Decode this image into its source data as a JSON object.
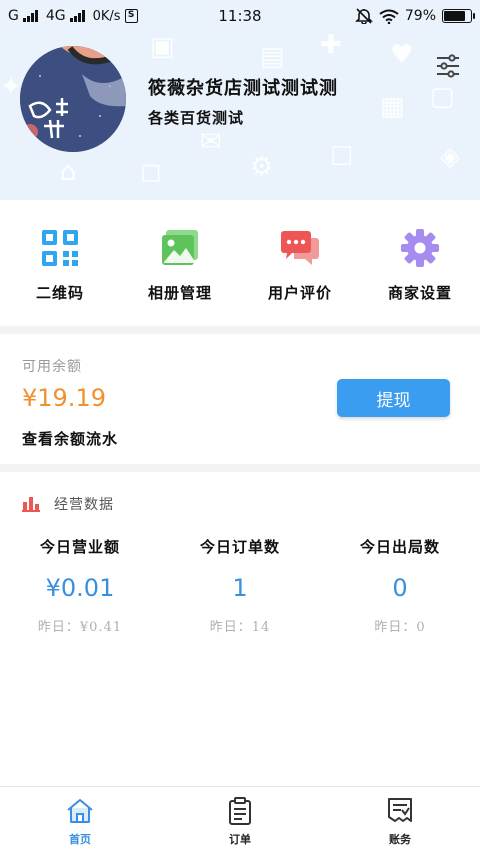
{
  "status_bar": {
    "carrier_a": "G",
    "carrier_b": "4G",
    "speed": "0K/s",
    "s_badge": "S",
    "time": "11:38",
    "battery": "79%",
    "icons": [
      "signal-icon",
      "mute-icon",
      "wifi-icon",
      "battery-icon"
    ]
  },
  "header": {
    "shop_name": "筱薇杂货店测试测试测",
    "shop_subtitle": "各类百货测试",
    "settings_icon": "sliders-icon"
  },
  "quick_menu": [
    {
      "label": "二维码",
      "icon": "qr-code-icon",
      "color": "#2fa6ef"
    },
    {
      "label": "相册管理",
      "icon": "album-icon",
      "color": "#5dc35a"
    },
    {
      "label": "用户评价",
      "icon": "chat-bubble-icon",
      "color": "#ee5555"
    },
    {
      "label": "商家设置",
      "icon": "gear-icon",
      "color": "#a78cf0"
    }
  ],
  "balance": {
    "label": "可用余额",
    "value": "¥19.19",
    "link": "查看余额流水",
    "withdraw": "提现",
    "value_color": "#f0912e",
    "button_color": "#3a9df0"
  },
  "business": {
    "title": "经营数据",
    "title_icon": "bar-chart-icon",
    "stats": [
      {
        "label": "今日营业额",
        "value": "¥0.01",
        "yesterday": "昨日：¥0.41"
      },
      {
        "label": "今日订单数",
        "value": "1",
        "yesterday": "昨日：14"
      },
      {
        "label": "今日出局数",
        "value": "0",
        "yesterday": "昨日：0"
      }
    ]
  },
  "bottom_nav": [
    {
      "label": "首页",
      "icon": "home-icon",
      "active": true
    },
    {
      "label": "订单",
      "icon": "order-clipboard-icon",
      "active": false
    },
    {
      "label": "账务",
      "icon": "bill-icon",
      "active": false
    }
  ],
  "colors": {
    "accent": "#3a8fe0",
    "header_bg": "#eaf3fc",
    "page_bg": "#f3f3f3"
  }
}
